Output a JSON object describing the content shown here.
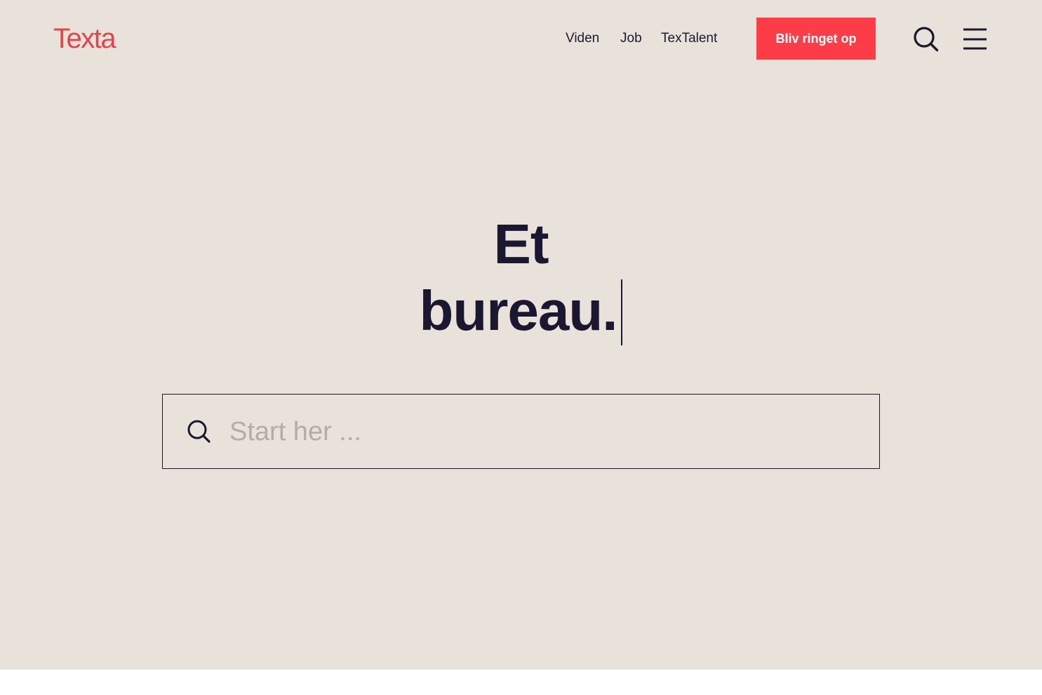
{
  "header": {
    "logo": "Texta",
    "nav": [
      {
        "label": "Viden"
      },
      {
        "label": "Job"
      },
      {
        "label": "TexTalent"
      }
    ],
    "cta_label": "Bliv ringet op",
    "search_icon": "search-icon",
    "menu_icon": "hamburger-menu-icon"
  },
  "hero": {
    "headline_line1": "Et",
    "headline_line2": "bureau.",
    "search": {
      "placeholder": "Start her ...",
      "value": "",
      "icon": "search-icon"
    }
  },
  "colors": {
    "background": "#e9e2db",
    "accent": "#fc3d48",
    "logo": "#e8414a",
    "text": "#1c1730"
  }
}
